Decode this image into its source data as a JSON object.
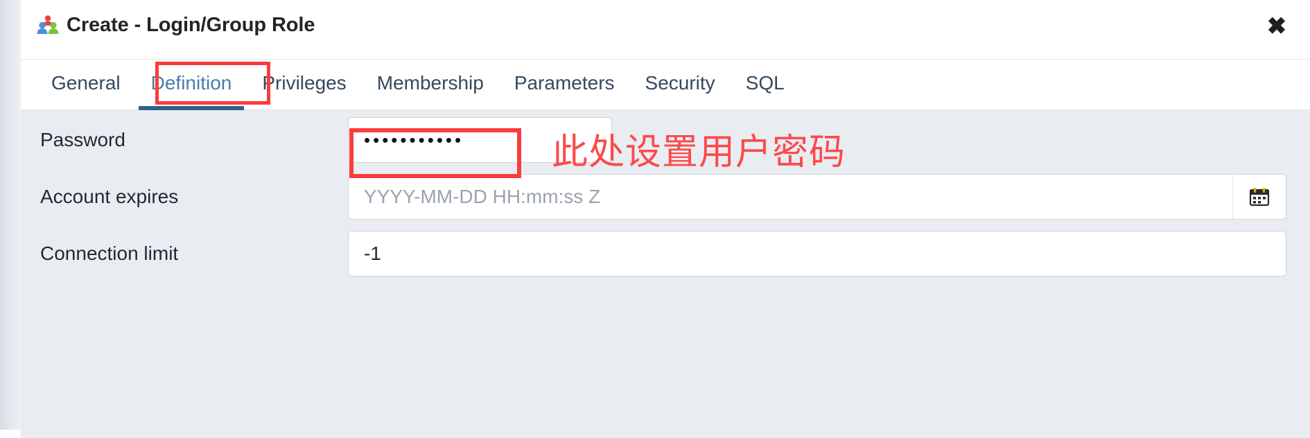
{
  "window": {
    "title": "Create - Login/Group Role",
    "title_icon": "group-role-icon",
    "close_label": "✖"
  },
  "tabs": [
    {
      "label": "General",
      "active": false
    },
    {
      "label": "Definition",
      "active": true
    },
    {
      "label": "Privileges",
      "active": false
    },
    {
      "label": "Membership",
      "active": false
    },
    {
      "label": "Parameters",
      "active": false
    },
    {
      "label": "Security",
      "active": false
    },
    {
      "label": "SQL",
      "active": false
    }
  ],
  "form": {
    "password": {
      "label": "Password",
      "value": "•••••••••••",
      "placeholder": ""
    },
    "account_expires": {
      "label": "Account expires",
      "value": "",
      "placeholder": "YYYY-MM-DD HH:mm:ss Z",
      "addon_icon": "calendar-icon"
    },
    "connection_limit": {
      "label": "Connection limit",
      "value": "-1",
      "placeholder": ""
    }
  },
  "annotations": {
    "tab_highlight_target": "Definition",
    "password_note": "此处设置用户密码",
    "color": "#fa3c3c"
  },
  "colors": {
    "accent_tab": "#30618c",
    "active_tab_text": "#4b7ba8",
    "annotation_red": "#fa3c3c",
    "form_background": "#e9edf2",
    "dialog_background": "#ffffff"
  }
}
